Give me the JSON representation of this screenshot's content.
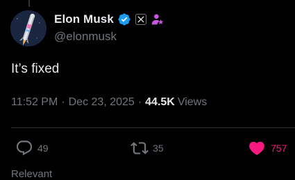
{
  "author": {
    "display_name": "Elon Musk",
    "handle": "@elonmusk",
    "verified": true,
    "affiliate_badge_icon": "x-logo-icon",
    "role_badge_icon": "person-star-icon"
  },
  "tweet": {
    "text": "It’s fixed",
    "time": "11:52 PM",
    "separator": "·",
    "date": "Dec 23, 2025",
    "views_count": "44.5K",
    "views_label": "Views"
  },
  "actions": {
    "reply": {
      "icon": "reply-bubble-icon",
      "count": "49"
    },
    "retweet": {
      "icon": "retweet-icon",
      "count": "35"
    },
    "like": {
      "icon": "heart-icon",
      "count": "757",
      "liked": true
    }
  },
  "footer": {
    "partial_text": "Relevant"
  },
  "colors": {
    "background": "#000000",
    "primary_text": "#e7e9ea",
    "secondary_text": "#71767b",
    "verified_blue": "#1d9bf0",
    "like_pink": "#f91880",
    "role_purple": "#c855e0",
    "divider": "#2f3336"
  }
}
